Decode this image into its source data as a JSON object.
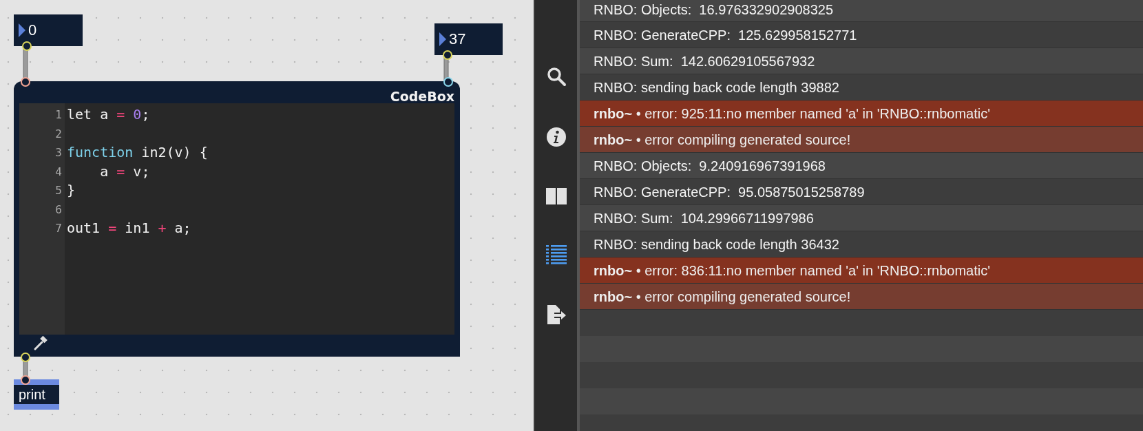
{
  "patcher": {
    "number_boxes": [
      {
        "value": "0"
      },
      {
        "value": "37"
      }
    ],
    "codebox": {
      "title": "CodeBox",
      "lines": [
        {
          "number": "1",
          "tokens": [
            {
              "text": "let a ",
              "kind": "plain"
            },
            {
              "text": "=",
              "kind": "operator"
            },
            {
              "text": " 0",
              "kind": "number"
            },
            {
              "text": ";",
              "kind": "plain"
            }
          ]
        },
        {
          "number": "2"
        },
        {
          "number": "3",
          "tokens": [
            {
              "text": "function",
              "kind": "keyword"
            },
            {
              "text": " in2(v) {",
              "kind": "plain"
            }
          ]
        },
        {
          "number": "4",
          "tokens": [
            {
              "text": "    a ",
              "kind": "plain"
            },
            {
              "text": "=",
              "kind": "operator"
            },
            {
              "text": " v;",
              "kind": "plain"
            }
          ]
        },
        {
          "number": "5",
          "tokens": [
            {
              "text": "}",
              "kind": "plain"
            }
          ]
        },
        {
          "number": "6"
        },
        {
          "number": "7",
          "tokens": [
            {
              "text": "out1 ",
              "kind": "plain"
            },
            {
              "text": "=",
              "kind": "operator"
            },
            {
              "text": " in1 ",
              "kind": "plain"
            },
            {
              "text": "+",
              "kind": "operator"
            },
            {
              "text": " a;",
              "kind": "plain"
            }
          ]
        }
      ]
    },
    "print_object": {
      "label": "print"
    }
  },
  "sidebar": {
    "items": [
      {
        "kind": "search",
        "selected": false
      },
      {
        "kind": "info",
        "selected": false
      },
      {
        "kind": "book",
        "selected": false
      },
      {
        "kind": "list",
        "selected": true
      },
      {
        "kind": "export",
        "selected": false
      }
    ]
  },
  "console": {
    "messages": [
      {
        "kind": "info",
        "text": "RNBO: Objects:  16.976332902908325"
      },
      {
        "kind": "info",
        "text": "RNBO: GenerateCPP:  125.629958152771"
      },
      {
        "kind": "info",
        "text": "RNBO: Sum:  142.60629105567932"
      },
      {
        "kind": "info",
        "text": "RNBO: sending back code length 39882"
      },
      {
        "kind": "error",
        "source": "rnbo~",
        "text": "• error: 925:11:no member named 'a' in 'RNBO::rnbomatic'"
      },
      {
        "kind": "error",
        "source": "rnbo~",
        "text": "• error compiling generated source!"
      },
      {
        "kind": "info",
        "text": "RNBO: Objects:  9.240916967391968"
      },
      {
        "kind": "info",
        "text": "RNBO: GenerateCPP:  95.05875015258789"
      },
      {
        "kind": "info",
        "text": "RNBO: Sum:  104.29966711997986"
      },
      {
        "kind": "info",
        "text": "RNBO: sending back code length 36432"
      },
      {
        "kind": "error",
        "source": "rnbo~",
        "text": "• error: 836:11:no member named 'a' in 'RNBO::rnbomatic'"
      },
      {
        "kind": "error",
        "source": "rnbo~",
        "text": "• error compiling generated source!"
      }
    ]
  }
}
